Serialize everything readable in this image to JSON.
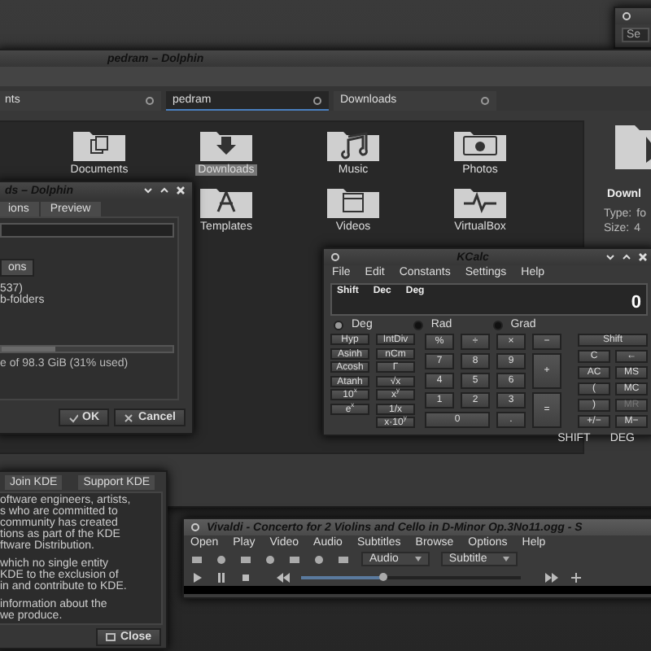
{
  "mini_window": {
    "field": "Se"
  },
  "dolphin": {
    "title": "pedram – Dolphin",
    "tabs": [
      {
        "label": "nts",
        "selected": false
      },
      {
        "label": "pedram",
        "selected": true
      },
      {
        "label": "Downloads",
        "selected": false
      }
    ],
    "items": [
      {
        "label": "Documents",
        "selected": false
      },
      {
        "label": "Downloads",
        "selected": true
      },
      {
        "label": "Music",
        "selected": false
      },
      {
        "label": "Photos",
        "selected": false
      },
      {
        "label": "Templates",
        "selected": false
      },
      {
        "label": "Videos",
        "selected": false
      },
      {
        "label": "VirtualBox",
        "selected": false
      }
    ],
    "info": {
      "name": "Downl",
      "rows": [
        {
          "label": "Type:",
          "value": "fo"
        },
        {
          "label": "Size:",
          "value": "4"
        }
      ]
    }
  },
  "properties": {
    "title": "ds – Dolphin",
    "tabs": [
      {
        "label": "ions",
        "selected": false
      },
      {
        "label": "Preview",
        "selected": false
      }
    ],
    "button": "ons",
    "lines": [
      "537)",
      "b-folders"
    ],
    "usage": {
      "level": 0.31,
      "text": "e of 98.3 GiB (31% used)"
    },
    "buttons": [
      {
        "kind": "ok",
        "label": "OK"
      },
      {
        "kind": "cancel",
        "label": "Cancel"
      }
    ]
  },
  "kcalc": {
    "title": "KCalc",
    "menu": [
      "File",
      "Edit",
      "Constants",
      "Settings",
      "Help"
    ],
    "display": {
      "status": [
        "Shift",
        "Dec",
        "Deg"
      ],
      "value": "0"
    },
    "angle_modes": [
      {
        "label": "Deg",
        "selected": true
      },
      {
        "label": "Rad",
        "selected": false
      },
      {
        "label": "Grad",
        "selected": false
      }
    ],
    "sci_left": [
      "Hyp",
      "Asinh",
      "Acosh",
      "Atanh",
      "10$^{x}$",
      "e$^{x}$"
    ],
    "sci_right": [
      "IntDiv",
      "nCm",
      "Γ",
      "√x",
      "x$^{y}$",
      "1/x",
      "x·10$^{y}$"
    ],
    "numpad": [
      {
        "label": "%",
        "kind": "normal"
      },
      {
        "label": "÷",
        "kind": "normal"
      },
      {
        "label": "×",
        "kind": "normal"
      },
      {
        "label": "−",
        "kind": "normal"
      },
      {
        "label": "7",
        "kind": "normal"
      },
      {
        "label": "8",
        "kind": "normal"
      },
      {
        "label": "9",
        "kind": "normal"
      },
      {
        "label": "+",
        "kind": "tall"
      },
      {
        "label": "4",
        "kind": "normal"
      },
      {
        "label": "5",
        "kind": "normal"
      },
      {
        "label": "6",
        "kind": "normal"
      },
      {
        "label": "1",
        "kind": "normal"
      },
      {
        "label": "2",
        "kind": "normal"
      },
      {
        "label": "3",
        "kind": "normal"
      },
      {
        "label": "=",
        "kind": "tall"
      },
      {
        "label": "0",
        "kind": "wide"
      },
      {
        "label": ".",
        "kind": "normal"
      }
    ],
    "memory": [
      {
        "label": "Shift",
        "kind": "wide",
        "disabled": false
      },
      {
        "label": "C",
        "kind": "normal",
        "disabled": false
      },
      {
        "label": "←",
        "kind": "normal",
        "disabled": false
      },
      {
        "label": "AC",
        "kind": "normal",
        "disabled": false
      },
      {
        "label": "MS",
        "kind": "normal",
        "disabled": false
      },
      {
        "label": "(",
        "kind": "normal",
        "disabled": false
      },
      {
        "label": "MC",
        "kind": "normal",
        "disabled": false
      },
      {
        "label": ")",
        "kind": "normal",
        "disabled": false
      },
      {
        "label": "MR",
        "kind": "normal",
        "disabled": true
      },
      {
        "label": "+/−",
        "kind": "normal",
        "disabled": false
      },
      {
        "label": "M−",
        "kind": "normal",
        "disabled": false
      }
    ],
    "status_bar": [
      "SHIFT",
      "DEG"
    ]
  },
  "about": {
    "tabs": [
      {
        "label": "Join KDE",
        "selected": false
      },
      {
        "label": "Support KDE",
        "selected": false
      }
    ],
    "paragraphs": [
      "oftware engineers, artists,\ns who are committed to\ncommunity has created\ntions as part of the KDE\nftware Distribution.",
      "which no single entity\nKDE to the exclusion of\nin and contribute to KDE.",
      "information about the\nwe produce."
    ],
    "close": "Close"
  },
  "player": {
    "title": "Vivaldi - Concerto for 2 Violins and Cello in D-Minor Op.3No11.ogg - S",
    "menu": [
      "Open",
      "Play",
      "Video",
      "Audio",
      "Subtitles",
      "Browse",
      "Options",
      "Help"
    ],
    "dropdowns": [
      "Audio",
      "Subtitle"
    ],
    "seek": {
      "level": 0.37
    }
  }
}
